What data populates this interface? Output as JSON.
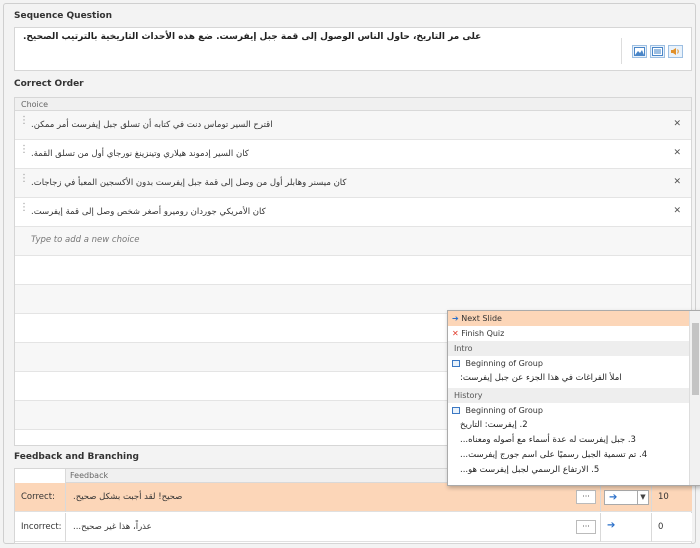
{
  "sections": {
    "sequence_question": "Sequence Question",
    "correct_order": "Correct Order",
    "feedback_branching": "Feedback and Branching"
  },
  "question": {
    "text": "على مر التاريخ، حاول الناس الوصول إلى قمة جبل إيفرست. ضع هذه الأحداث التاريخية بالترتيب الصحيح."
  },
  "order_table": {
    "column": "Choice",
    "choices": [
      "اقترح السير توماس دنت في كتابه أن تسلق جبل إيفرست أمر ممكن.",
      "كان السير إدموند هيلاري وتينزينغ نورجاي أول من تسلق القمة.",
      "كان ميسنر وهابلر أول من وصل إلى قمة جبل إيفرست بدون الأكسجين المعبأ في زجاجات.",
      "كان الأمريكي جوردان روميرو أصغر شخص وصل إلى قمة إيفرست."
    ],
    "new_placeholder": "Type to add a new choice"
  },
  "feedback": {
    "column": "Feedback",
    "rows": [
      {
        "label": "Correct:",
        "text": "صحيح! لقد أجبت بشكل صحيح.",
        "score": "10"
      },
      {
        "label": "Incorrect:",
        "text": "عذراً، هذا غير صحيح...",
        "score": "0"
      }
    ],
    "dots": "···"
  },
  "dropdown": {
    "items": [
      {
        "kind": "item",
        "icon": "arrow",
        "label": "Next Slide"
      },
      {
        "kind": "item",
        "icon": "x",
        "label": "Finish Quiz"
      },
      {
        "kind": "group",
        "label": "Intro"
      },
      {
        "kind": "item",
        "icon": "group",
        "label": "Beginning of Group"
      },
      {
        "kind": "sub",
        "label": "املأ الفراغات في هذا الجزء عن جبل إيفرست:"
      },
      {
        "kind": "group",
        "label": "History"
      },
      {
        "kind": "item",
        "icon": "group",
        "label": "Beginning of Group"
      },
      {
        "kind": "sub",
        "label": "2. إيفرست: التاريخ"
      },
      {
        "kind": "sub",
        "label": "3. جبل إيفرست له عدة أسماء مع أصوله ومعناه..."
      },
      {
        "kind": "sub",
        "label": "4. تم تسمية الجبل رسميًا على اسم جورج إيفرست..."
      },
      {
        "kind": "sub",
        "label": "5. الارتفاع الرسمي لجبل إيفرست هو..."
      }
    ]
  },
  "colors": {
    "highlight": "#fcd6b8",
    "accent": "#2a6fc9",
    "remove": "#e03b2b"
  }
}
